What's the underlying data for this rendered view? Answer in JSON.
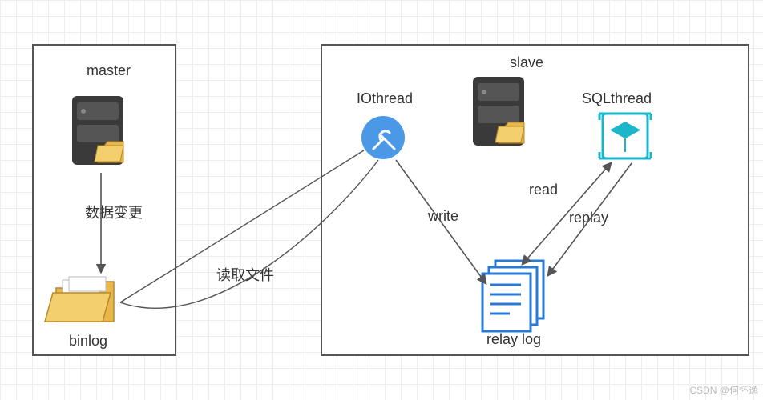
{
  "diagram": {
    "master": {
      "title": "master",
      "server_label": "",
      "arrow_data_change": "数据变更",
      "binlog_label": "binlog"
    },
    "slave": {
      "title": "slave",
      "iothread": "IOthread",
      "sqlthread": "SQLthread",
      "write": "write",
      "read": "read",
      "replay": "replay",
      "relay_log": "relay log"
    },
    "link_read_file": "读取文件",
    "watermark": "CSDN @何怀逸"
  }
}
